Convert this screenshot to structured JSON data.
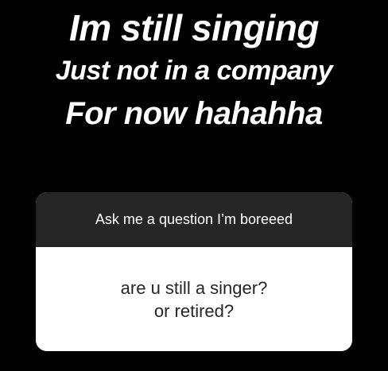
{
  "story": {
    "text_lines": [
      "Im still singing",
      "Just not in a company",
      "For now hahahha"
    ]
  },
  "question_sticker": {
    "prompt": "Ask me a question I’m boreeed",
    "response_lines": [
      "are u still a singer?",
      "or retired?"
    ]
  },
  "colors": {
    "background": "#000000",
    "header_bg": "#262626",
    "card_bg": "#ffffff",
    "text_light": "#ffffff",
    "text_dark": "#262626"
  }
}
